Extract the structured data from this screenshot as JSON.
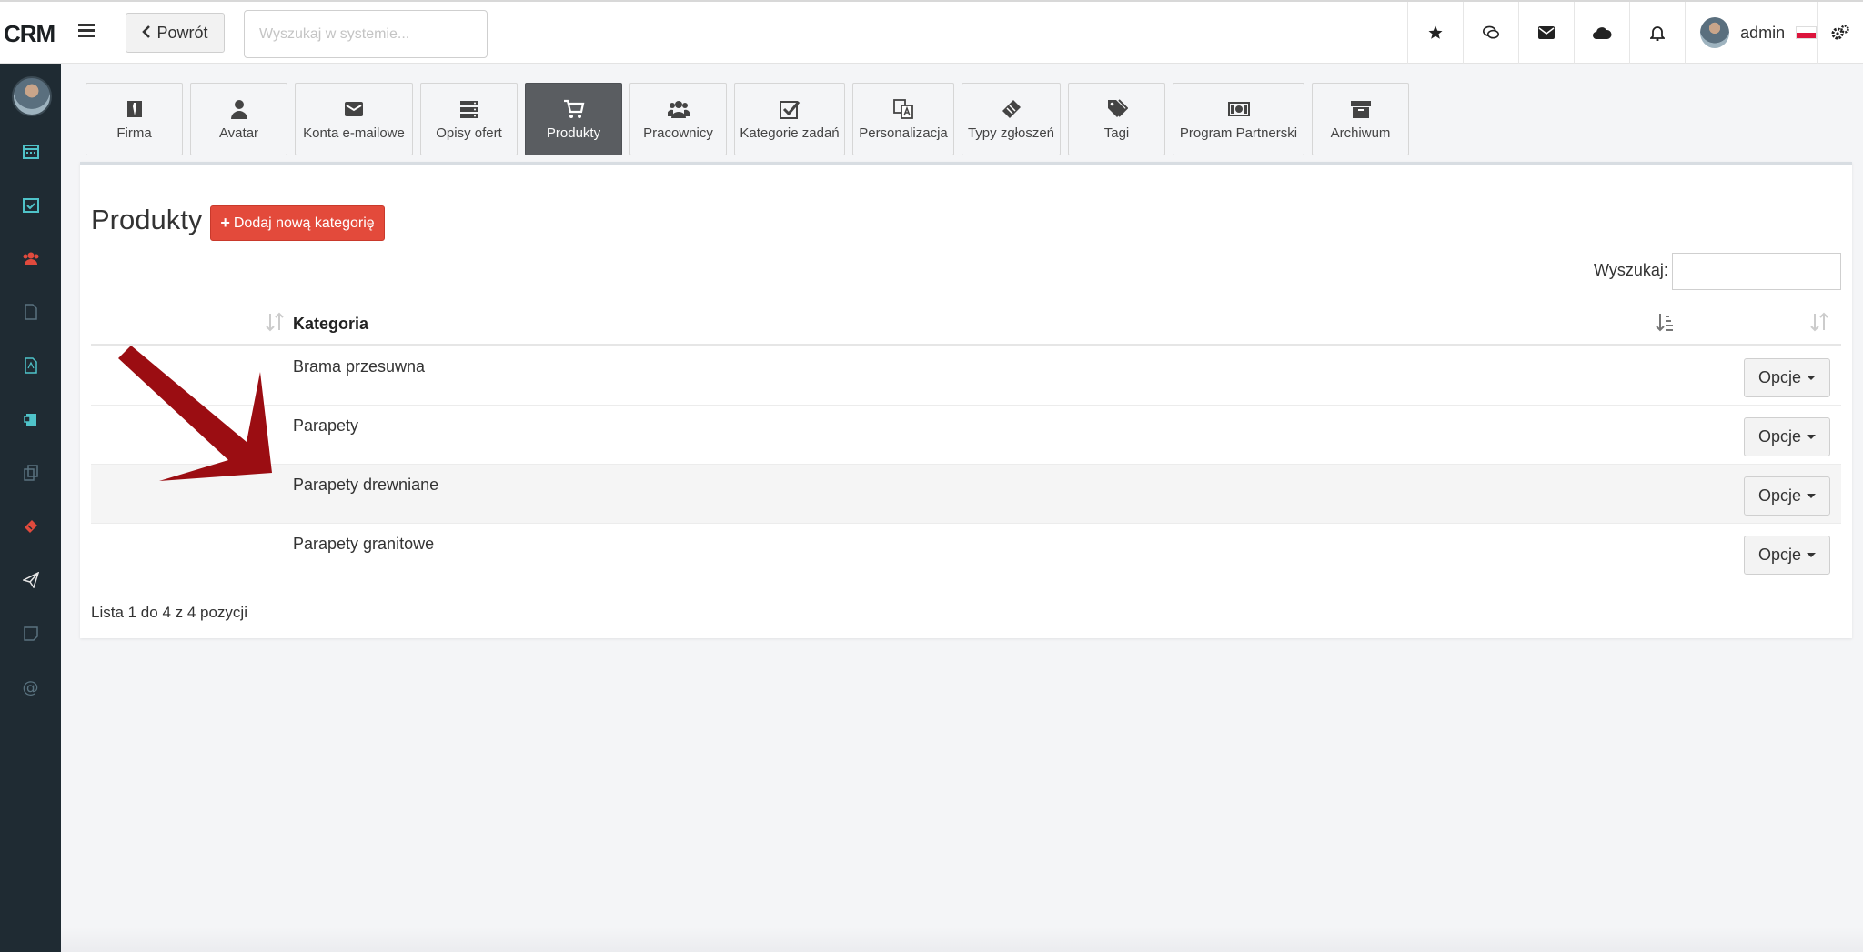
{
  "app": {
    "logo": "CRM"
  },
  "topbar": {
    "back_label": "Powrót",
    "search_placeholder": "Wyszukaj w systemie...",
    "username": "admin"
  },
  "tabs": [
    {
      "label": "Firma",
      "icon": "tie-icon",
      "active": false
    },
    {
      "label": "Avatar",
      "icon": "user-icon",
      "active": false
    },
    {
      "label": "Konta e-mailowe",
      "icon": "envelope-icon",
      "active": false
    },
    {
      "label": "Opisy ofert",
      "icon": "server-icon",
      "active": false
    },
    {
      "label": "Produkty",
      "icon": "cart-icon",
      "active": true
    },
    {
      "label": "Pracownicy",
      "icon": "users-icon",
      "active": false
    },
    {
      "label": "Kategorie zadań",
      "icon": "check-square-icon",
      "active": false
    },
    {
      "label": "Personalizacja",
      "icon": "translate-icon",
      "active": false
    },
    {
      "label": "Typy zgłoszeń",
      "icon": "ticket-icon",
      "active": false
    },
    {
      "label": "Tagi",
      "icon": "tags-icon",
      "active": false
    },
    {
      "label": "Program Partnerski",
      "icon": "money-icon",
      "active": false
    },
    {
      "label": "Archiwum",
      "icon": "archive-icon",
      "active": false
    }
  ],
  "page": {
    "title": "Produkty",
    "add_button": "Dodaj nową kategorię",
    "search_label": "Wyszukaj:",
    "column_header": "Kategoria",
    "options_label": "Opcje",
    "footer": "Lista 1 do 4 z 4 pozycji",
    "rows": [
      {
        "name": "Brama przesuwna"
      },
      {
        "name": "Parapety"
      },
      {
        "name": "Parapety drewniane"
      },
      {
        "name": "Parapety granitowe"
      }
    ]
  },
  "colors": {
    "sidebar": "#1f2b33",
    "accent_red": "#e34a3b",
    "active_tab": "#5a5d61",
    "annotation_arrow": "#9b0d12"
  }
}
